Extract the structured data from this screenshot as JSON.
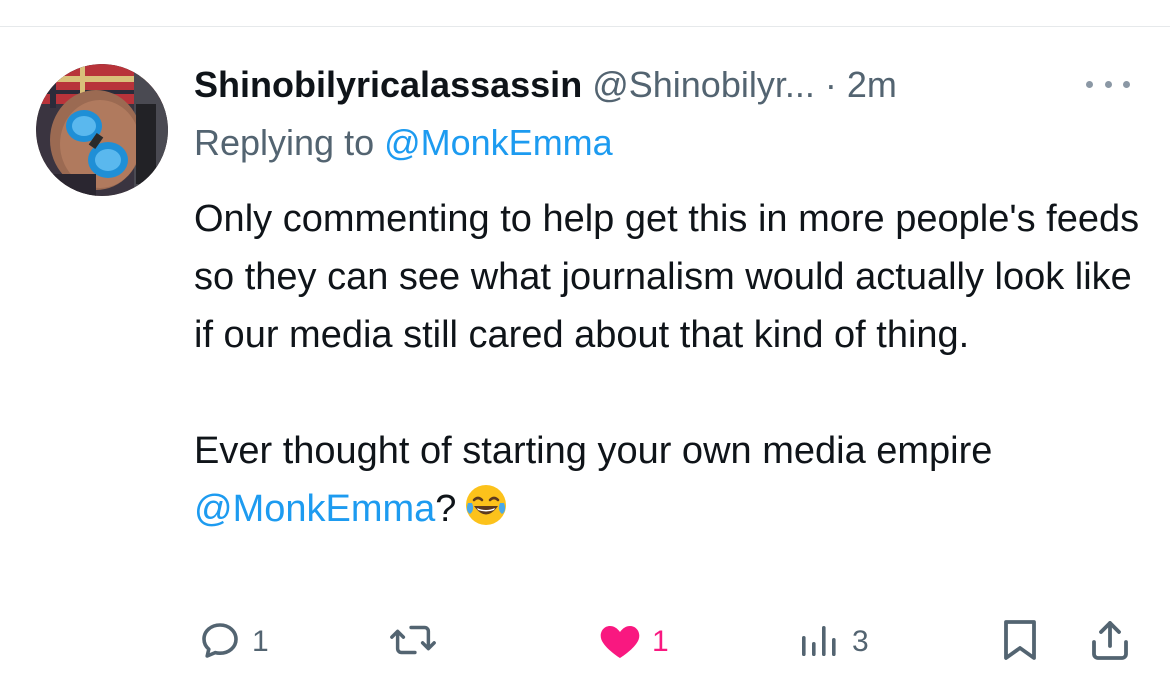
{
  "tweet": {
    "display_name": "Shinobilyricalassassin",
    "handle": "@Shinobilyr...",
    "separator": "·",
    "time": "2m",
    "replying_prefix": "Replying to ",
    "replying_to": "@MonkEmma",
    "body_paragraph_1": "Only commenting to help get this in more people's feeds so they can see what journalism would actually look like if our media still cared about that kind of thing.",
    "body_paragraph_2_prefix": "Ever thought of starting your own media empire ",
    "body_paragraph_2_mention": "@MonkEmma",
    "body_paragraph_2_suffix": "?",
    "emoji": "face-with-tears-of-joy"
  },
  "actions": {
    "reply": {
      "icon": "reply-icon",
      "count": "1"
    },
    "retweet": {
      "icon": "retweet-icon",
      "count": ""
    },
    "like": {
      "icon": "heart-icon",
      "count": "1",
      "liked": true,
      "color": "#f91880"
    },
    "views": {
      "icon": "views-icon",
      "count": "3"
    },
    "bookmark": {
      "icon": "bookmark-icon"
    },
    "share": {
      "icon": "share-icon"
    }
  },
  "colors": {
    "text": "#0f1419",
    "secondary": "#536471",
    "link": "#1d9bf0",
    "like": "#f91880"
  }
}
